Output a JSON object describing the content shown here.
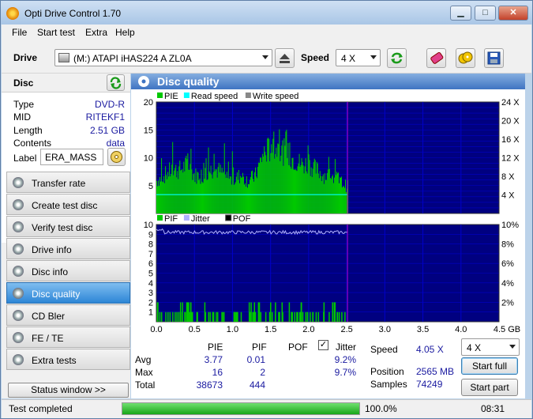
{
  "window": {
    "title": "Opti Drive Control 1.70",
    "min": "▁",
    "max": "□",
    "close": "✕"
  },
  "menu": [
    "File",
    "Start test",
    "Extra",
    "Help"
  ],
  "toolbar": {
    "drive_label": "Drive",
    "drive_value": "(M:)   ATAPI iHAS224   A ZL0A",
    "speed_label": "Speed",
    "speed_value": "4 X"
  },
  "icons": {
    "app": "app-disc-icon",
    "drive": "drive-icon",
    "eject": "eject-icon",
    "refresh": "refresh-icon",
    "eraser": "eraser-icon",
    "copy": "copy-disc-icon",
    "save": "save-icon",
    "disc_refresh": "disc-refresh-icon",
    "label_disc": "disc-label-icon",
    "section": "disc-quality-icon"
  },
  "disc": {
    "heading": "Disc",
    "fields": [
      {
        "key": "Type",
        "value": "DVD-R"
      },
      {
        "key": "MID",
        "value": "RITEKF1"
      },
      {
        "key": "Length",
        "value": "2.51 GB"
      },
      {
        "key": "Contents",
        "value": "data"
      }
    ],
    "label_key": "Label",
    "label_value": "ERA_MASS"
  },
  "nav": [
    {
      "label": "Transfer rate",
      "active": false
    },
    {
      "label": "Create test disc",
      "active": false
    },
    {
      "label": "Verify test disc",
      "active": false
    },
    {
      "label": "Drive info",
      "active": false
    },
    {
      "label": "Disc info",
      "active": false
    },
    {
      "label": "Disc quality",
      "active": true
    },
    {
      "label": "CD Bler",
      "active": false
    },
    {
      "label": "FE / TE",
      "active": false
    },
    {
      "label": "Extra tests",
      "active": false
    }
  ],
  "status_window_btn": "Status window >>",
  "section_title": "Disc quality",
  "chart_data": [
    {
      "type": "bar",
      "legend": [
        "PIE",
        "Read speed",
        "Write speed"
      ],
      "colors": {
        "bars": "#00c800",
        "read": "#00ffff",
        "write": "#888888",
        "bg": "#000080",
        "grid": "#0000c8",
        "marker": "#c000c0"
      },
      "x_ticks": [
        "0.0",
        "0.5",
        "1.0",
        "1.5",
        "2.0",
        "2.5",
        "3.0",
        "3.5",
        "4.0",
        "4.5 GB"
      ],
      "y_left_ticks": [
        "20",
        "15",
        "10",
        "5"
      ],
      "y_right_ticks": [
        "24 X",
        "20 X",
        "16 X",
        "12 X",
        "8 X",
        "4 X"
      ],
      "xlim": [
        0,
        4.5
      ],
      "ylim": [
        0,
        20
      ],
      "read_speed_x": 4.05,
      "data_end": 2.51,
      "pie_profile": [
        [
          0.0,
          6
        ],
        [
          0.1,
          7
        ],
        [
          0.2,
          8
        ],
        [
          0.3,
          8
        ],
        [
          0.4,
          9
        ],
        [
          0.5,
          7
        ],
        [
          0.6,
          7
        ],
        [
          0.7,
          8
        ],
        [
          0.8,
          8
        ],
        [
          0.9,
          7
        ],
        [
          1.0,
          6
        ],
        [
          1.1,
          7
        ],
        [
          1.2,
          6
        ],
        [
          1.3,
          7
        ],
        [
          1.4,
          11
        ],
        [
          1.5,
          12
        ],
        [
          1.6,
          12
        ],
        [
          1.7,
          11
        ],
        [
          1.8,
          10
        ],
        [
          1.9,
          9
        ],
        [
          2.0,
          9
        ],
        [
          2.1,
          8
        ],
        [
          2.2,
          7
        ],
        [
          2.3,
          7
        ],
        [
          2.4,
          6
        ],
        [
          2.5,
          5
        ]
      ]
    },
    {
      "type": "bar",
      "legend": [
        "PIF",
        "Jitter",
        "POF"
      ],
      "colors": {
        "bars": "#00c800",
        "jitter": "#b0b0ff",
        "pof": "#000000",
        "bg": "#000080",
        "grid": "#0000c8",
        "marker": "#c000c0"
      },
      "x_ticks": [
        "0.0",
        "0.5",
        "1.0",
        "1.5",
        "2.0",
        "2.5",
        "3.0",
        "3.5",
        "4.0",
        "4.5 GB"
      ],
      "y_left_ticks": [
        "10",
        "9",
        "8",
        "7",
        "6",
        "5",
        "4",
        "3",
        "2",
        "1"
      ],
      "y_right_ticks": [
        "10%",
        "8%",
        "6%",
        "4%",
        "2%"
      ],
      "xlim": [
        0,
        4.5
      ],
      "ylim": [
        0,
        10
      ],
      "jitter_pct": 9.2,
      "data_end": 2.51
    }
  ],
  "stats": {
    "headers": [
      "PIE",
      "PIF",
      "POF",
      "Jitter"
    ],
    "rows": [
      {
        "label": "Avg",
        "pie": "3.77",
        "pif": "0.01",
        "jitter": "9.2%"
      },
      {
        "label": "Max",
        "pie": "16",
        "pif": "2",
        "jitter": "9.7%"
      },
      {
        "label": "Total",
        "pie": "38673",
        "pif": "444",
        "jitter": ""
      }
    ],
    "speed_label": "Speed",
    "speed_value": "4.05 X",
    "position_label": "Position",
    "position_value": "2565 MB",
    "samples_label": "Samples",
    "samples_value": "74249",
    "speed_select": "4 X",
    "start_full": "Start full",
    "start_part": "Start part"
  },
  "status": {
    "text": "Test completed",
    "progress_label": "100.0%",
    "progress": 1.0,
    "time": "08:31"
  }
}
